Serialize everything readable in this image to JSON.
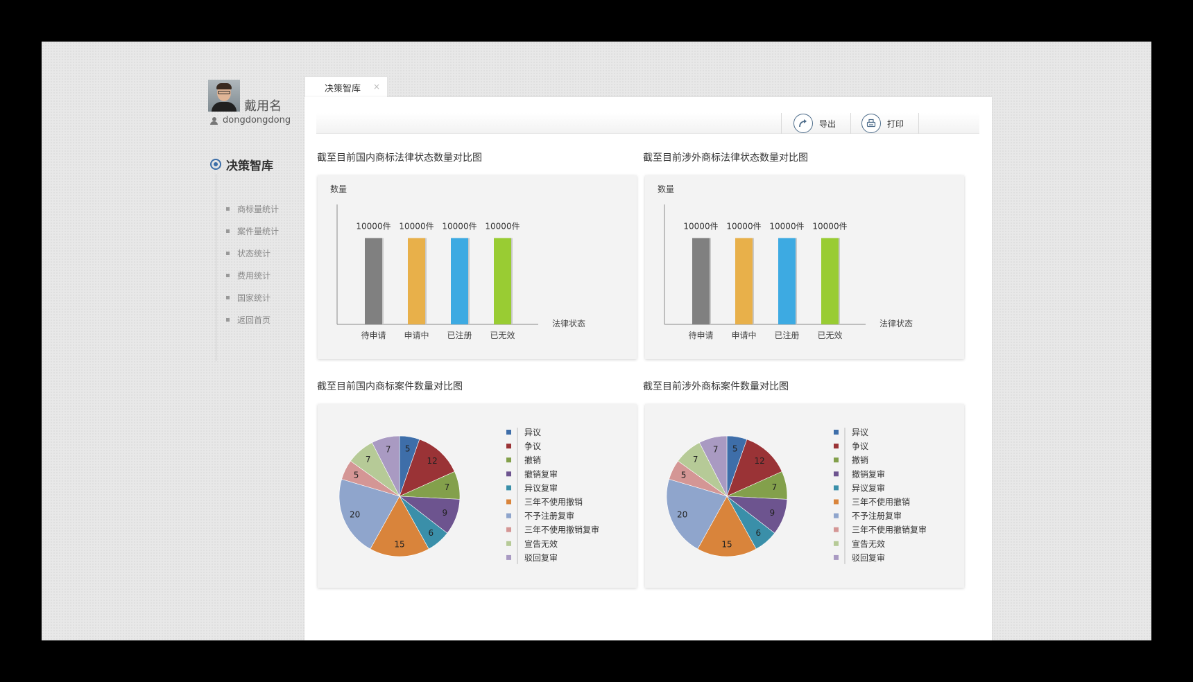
{
  "user": {
    "display_name": "戴用名",
    "username": "dongdongdong"
  },
  "sidebar": {
    "section_title": "决策智库",
    "items": [
      {
        "label": "商标量统计"
      },
      {
        "label": "案件量统计"
      },
      {
        "label": "状态统计"
      },
      {
        "label": "费用统计"
      },
      {
        "label": "国家统计"
      },
      {
        "label": "返回首页"
      }
    ]
  },
  "tab": {
    "label": "决策智库",
    "close": "×"
  },
  "toolbar": {
    "export_label": "导出",
    "print_label": "打印"
  },
  "colors": {
    "bar_colors": [
      "#808080",
      "#e8b04a",
      "#3daae2",
      "#99cc33"
    ],
    "pie_colors": [
      "#3e6ea9",
      "#9a3336",
      "#83a04b",
      "#6d548f",
      "#3a8fa9",
      "#d9843b",
      "#8fa5cc",
      "#d49695",
      "#b6ca97",
      "#a99ac2"
    ]
  },
  "chart_data": [
    {
      "type": "bar",
      "title": "截至目前国内商标法律状态数量对比图",
      "ylabel": "数量",
      "xlabel": "法律状态",
      "categories": [
        "待申请",
        "申请中",
        "已注册",
        "已无效"
      ],
      "values": [
        10000,
        10000,
        10000,
        10000
      ],
      "value_labels": [
        "10000件",
        "10000件",
        "10000件",
        "10000件"
      ]
    },
    {
      "type": "bar",
      "title": "截至目前涉外商标法律状态数量对比图",
      "ylabel": "数量",
      "xlabel": "法律状态",
      "categories": [
        "待申请",
        "申请中",
        "已注册",
        "已无效"
      ],
      "values": [
        10000,
        10000,
        10000,
        10000
      ],
      "value_labels": [
        "10000件",
        "10000件",
        "10000件",
        "10000件"
      ]
    },
    {
      "type": "pie",
      "title": "截至目前国内商标案件数量对比图",
      "categories": [
        "异议",
        "争议",
        "撤销",
        "撤销复审",
        "异议复审",
        "三年不使用撤销",
        "不予注册复审",
        "三年不使用撤销复审",
        "宣告无效",
        "驳回复审"
      ],
      "values": [
        5,
        12,
        7,
        9,
        6,
        15,
        20,
        5,
        7,
        7
      ]
    },
    {
      "type": "pie",
      "title": "截至目前涉外商标案件数量对比图",
      "categories": [
        "异议",
        "争议",
        "撤销",
        "撤销复审",
        "异议复审",
        "三年不使用撤销",
        "不予注册复审",
        "三年不使用撤销复审",
        "宣告无效",
        "驳回复审"
      ],
      "values": [
        5,
        12,
        7,
        9,
        6,
        15,
        20,
        5,
        7,
        7
      ]
    }
  ]
}
